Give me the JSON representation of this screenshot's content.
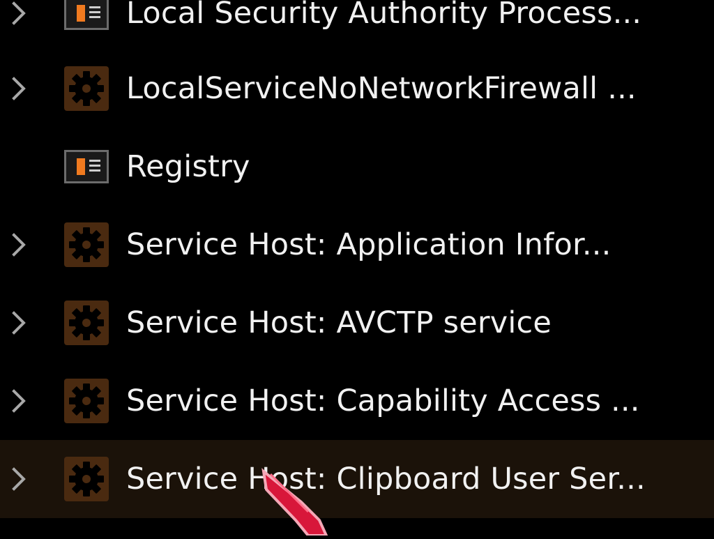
{
  "colors": {
    "background": "#000000",
    "hover_row": "#1b1209",
    "text": "#f1f1f1",
    "chevron": "#a8a8a8",
    "gear_tile": "#4a2a10",
    "app_frame": "#6c6c6c",
    "app_accent": "#f07a1f"
  },
  "processes": [
    {
      "label": "Local Security Authority Process...",
      "icon": "app-window-icon",
      "expandable": true
    },
    {
      "label": "LocalServiceNoNetworkFirewall ...",
      "icon": "gear-icon",
      "expandable": true
    },
    {
      "label": "Registry",
      "icon": "app-window-icon",
      "expandable": false
    },
    {
      "label": "Service Host: Application Infor...",
      "icon": "gear-icon",
      "expandable": true
    },
    {
      "label": "Service Host: AVCTP service",
      "icon": "gear-icon",
      "expandable": true
    },
    {
      "label": "Service Host: Capability Access ...",
      "icon": "gear-icon",
      "expandable": true
    },
    {
      "label": "Service Host: Clipboard User Ser...",
      "icon": "gear-icon",
      "expandable": true,
      "hovered": true
    }
  ],
  "cursor": {
    "icon": "cursor-arrow-icon"
  }
}
